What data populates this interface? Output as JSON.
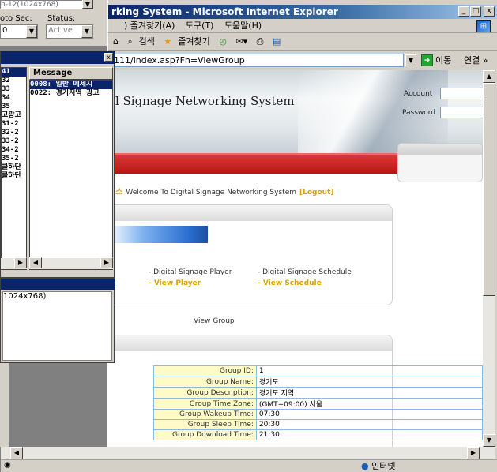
{
  "ie": {
    "title": "rking System - Microsoft Internet Explorer",
    "caption_buttons": [
      "_",
      "□",
      "x"
    ],
    "menu": [
      ") 즐겨찾기(A)",
      "도구(T)",
      "도움말(H)"
    ],
    "toolbar": [
      "검색",
      "즐겨찾기"
    ],
    "address": "111/index.asp?Fn=ViewGroup",
    "go_label": "이동",
    "links_label": "연결 »",
    "status_zone": "인터넷"
  },
  "page": {
    "banner_title": "al Signage Networking System",
    "account_label": "Account",
    "password_label": "Password",
    "welcome_sis": "시스",
    "welcome_text": "Welcome To Digital Signage Networking System",
    "logout": "[Logout]",
    "menu": [
      {
        "title": "- Digital Signage Player",
        "link": "- View Player"
      },
      {
        "title": "- Digital Signage Schedule",
        "link": "- View Schedule"
      }
    ],
    "view_group": "View Group",
    "group_table": [
      {
        "label": "Group ID:",
        "value": "1"
      },
      {
        "label": "Group Name:",
        "value": "경기도"
      },
      {
        "label": "Group Description:",
        "value": "경기도 지역"
      },
      {
        "label": "Group Time Zone:",
        "value": "(GMT+09:00) 서울"
      },
      {
        "label": "Group Wakeup Time:",
        "value": "07:30"
      },
      {
        "label": "Group Sleep Time:",
        "value": "20:30"
      },
      {
        "label": "Group Download Time:",
        "value": "21:30"
      }
    ]
  },
  "left_app": {
    "top_combo_text": "b-12(1024x768)",
    "photo_sec_label": "oto Sec:",
    "photo_sec_value": "0",
    "status_label": "Status:",
    "status_value": "Active",
    "panel_close": "x",
    "message_header": "Message",
    "list_a": [
      "41",
      "32",
      "33",
      "34",
      "35",
      "고광고",
      "31-2",
      "32-2",
      "33-2",
      "34-2",
      "35-2",
      "클하단",
      "클하단"
    ],
    "list_b": [
      "0008: 일반 메세지",
      "0022: 경기지역 광고"
    ],
    "bottom_text": "1024x768)"
  }
}
